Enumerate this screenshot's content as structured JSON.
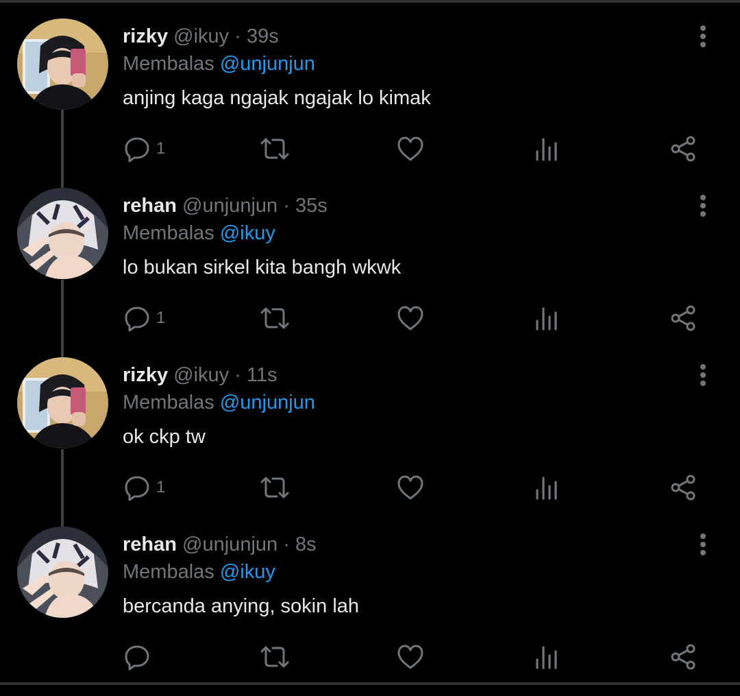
{
  "colors": {
    "background": "#000000",
    "text_primary": "#e7e9ea",
    "text_secondary": "#71767b",
    "accent": "#1d9bf0",
    "thread_line": "#3e4144"
  },
  "tweets": [
    {
      "name": "rizky",
      "handle": "@ikuy",
      "separator": "·",
      "time": "39s",
      "reply_prefix": "Membalas",
      "reply_to": "@unjunjun",
      "text": "anjing kaga ngajak ngajak lo kimak",
      "reply_count": "1",
      "avatar": "rizky-avatar"
    },
    {
      "name": "rehan",
      "handle": "@unjunjun",
      "separator": "·",
      "time": "35s",
      "reply_prefix": "Membalas",
      "reply_to": "@ikuy",
      "text": "lo bukan sirkel kita bangh wkwk",
      "reply_count": "1",
      "avatar": "rehan-avatar"
    },
    {
      "name": "rizky",
      "handle": "@ikuy",
      "separator": "·",
      "time": "11s",
      "reply_prefix": "Membalas",
      "reply_to": "@unjunjun",
      "text": "ok ckp tw",
      "reply_count": "1",
      "avatar": "rizky-avatar"
    },
    {
      "name": "rehan",
      "handle": "@unjunjun",
      "separator": "·",
      "time": "8s",
      "reply_prefix": "Membalas",
      "reply_to": "@ikuy",
      "text": "bercanda anying, sokin lah",
      "reply_count": "",
      "avatar": "rehan-avatar"
    }
  ],
  "icons": {
    "reply": "reply-icon",
    "retweet": "retweet-icon",
    "like": "heart-icon",
    "views": "views-icon",
    "share": "share-icon",
    "more": "more-vertical-icon"
  }
}
